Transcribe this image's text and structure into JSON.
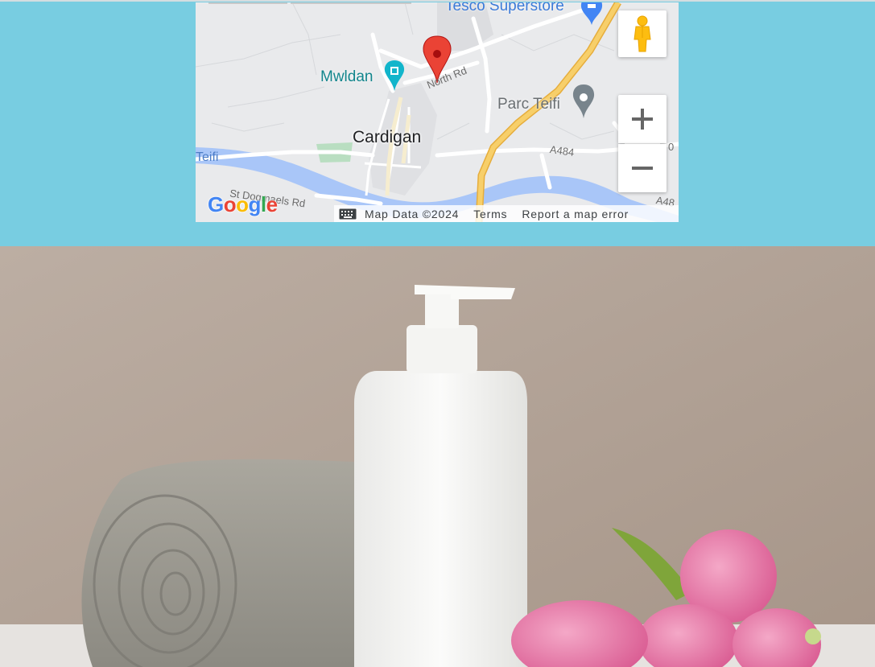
{
  "map": {
    "town_label": "Cardigan",
    "pois": {
      "cinema": "Mwldan",
      "park": "Parc Teifi",
      "store": "Tesco Superstore"
    },
    "roads": {
      "north_rd": "North Rd",
      "a484": "A484",
      "a484_right": "0",
      "st_dogmaels": "St Dogmaels Rd",
      "a48_edge": "A48"
    },
    "river_label": "Teifi",
    "logo": "Google",
    "attribution": {
      "map_data": "Map Data ©2024",
      "terms": "Terms",
      "report": "Report a map error"
    },
    "controls": {
      "zoom_in": "+",
      "zoom_out": "−"
    }
  },
  "colors": {
    "page_background": "#78cde1",
    "map_land": "#e9eaec",
    "river": "#a9c6f8",
    "highway": "#f4c35a",
    "marker": "#ea4335",
    "wall": "#b3a397"
  },
  "photo": {
    "subject": "white pump bottle with rolled grey towel and pink tulips"
  }
}
